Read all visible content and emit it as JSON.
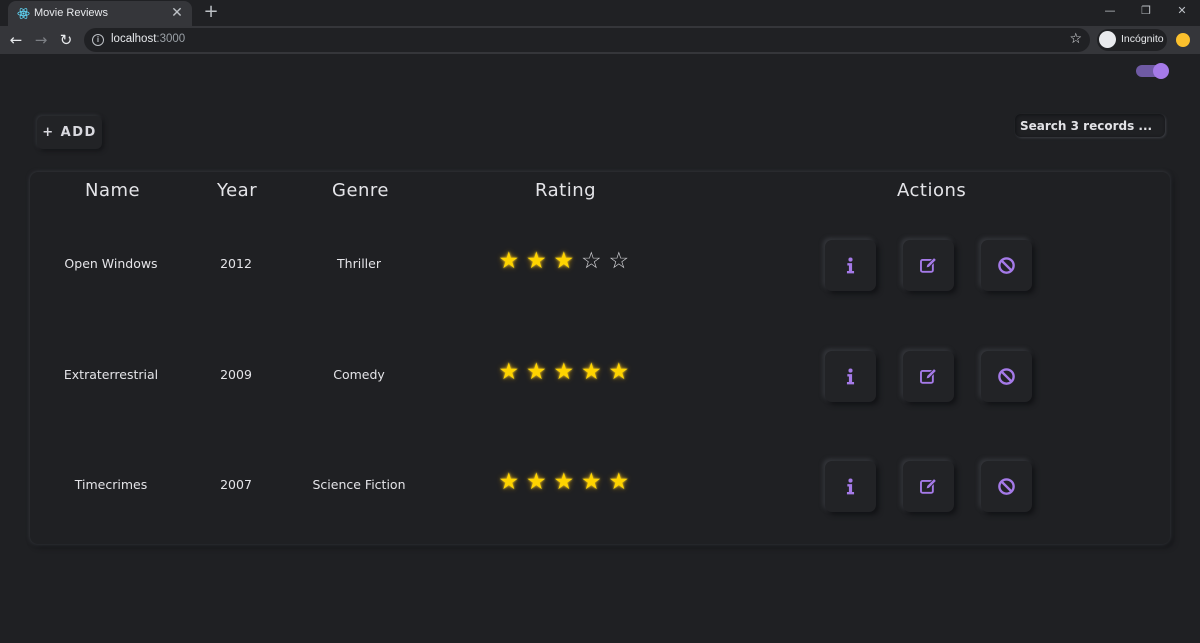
{
  "browser": {
    "tab_title": "Movie Reviews",
    "tab_close": "✕",
    "new_tab": "+",
    "url_host": "localhost",
    "url_port": ":3000",
    "incognito_label": "Incógnito"
  },
  "app": {
    "add_label": "+ ADD",
    "search_placeholder": "Search 3 records ...",
    "theme_toggle_on": true,
    "accent_color": "#a57ae8",
    "star_color": "#ffd400"
  },
  "table": {
    "headers": {
      "name": "Name",
      "year": "Year",
      "genre": "Genre",
      "rating": "Rating",
      "actions": "Actions"
    },
    "max_rating": 5,
    "rows": [
      {
        "name": "Open Windows",
        "year": "2012",
        "genre": "Thriller",
        "rating": 3
      },
      {
        "name": "Extraterrestrial",
        "year": "2009",
        "genre": "Comedy",
        "rating": 5
      },
      {
        "name": "Timecrimes",
        "year": "2007",
        "genre": "Science Fiction",
        "rating": 5
      }
    ],
    "action_icons": [
      "info-icon",
      "edit-icon",
      "ban-icon"
    ]
  }
}
